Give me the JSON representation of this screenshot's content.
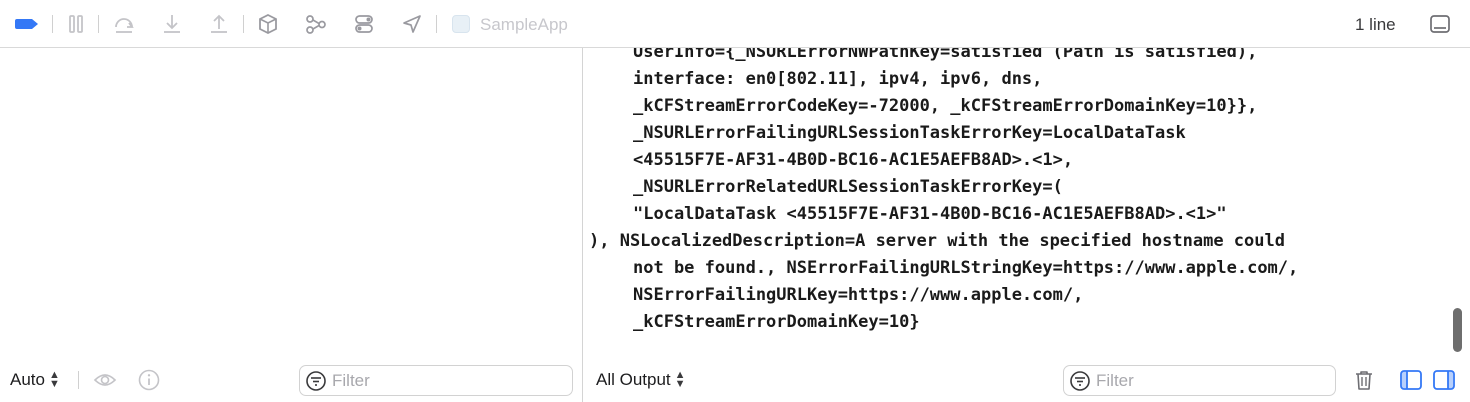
{
  "toolbar": {
    "app_name": "SampleApp",
    "line_count": "1 line",
    "icons": [
      "breakpoint-icon",
      "pause-icon",
      "step-over-icon",
      "step-into-icon",
      "step-out-icon",
      "debug-view-hierarchy-icon",
      "memory-graph-icon",
      "environment-overrides-icon",
      "simulate-location-icon",
      "app-icon",
      "hide-console-icon"
    ]
  },
  "console": {
    "lines": [
      {
        "text": "UserInfo={_NSURLErrorNWPathKey=satisfied (Path is satisfied),",
        "indent": true
      },
      {
        "text": "interface: en0[802.11], ipv4, ipv6, dns,",
        "indent": true
      },
      {
        "text": "_kCFStreamErrorCodeKey=-72000, _kCFStreamErrorDomainKey=10}},",
        "indent": true
      },
      {
        "text": "_NSURLErrorFailingURLSessionTaskErrorKey=LocalDataTask",
        "indent": true
      },
      {
        "text": "<45515F7E-AF31-4B0D-BC16-AC1E5AEFB8AD>.<1>,",
        "indent": true
      },
      {
        "text": "_NSURLErrorRelatedURLSessionTaskErrorKey=(",
        "indent": true
      },
      {
        "text": "\"LocalDataTask <45515F7E-AF31-4B0D-BC16-AC1E5AEFB8AD>.<1>\"",
        "indent": true
      },
      {
        "text": "), NSLocalizedDescription=A server with the specified hostname could",
        "indent": false
      },
      {
        "text": "not be found., NSErrorFailingURLStringKey=https://www.apple.com/,",
        "indent": true
      },
      {
        "text": "NSErrorFailingURLKey=https://www.apple.com/,",
        "indent": true
      },
      {
        "text": "_kCFStreamErrorDomainKey=10}",
        "indent": true
      }
    ]
  },
  "variables_bar": {
    "scope_picker": "Auto",
    "filter_placeholder": "Filter"
  },
  "console_bar": {
    "output_picker": "All Output",
    "filter_placeholder": "Filter"
  },
  "colors": {
    "accent": "#3478f6",
    "disabled": "#c7c7cc"
  }
}
